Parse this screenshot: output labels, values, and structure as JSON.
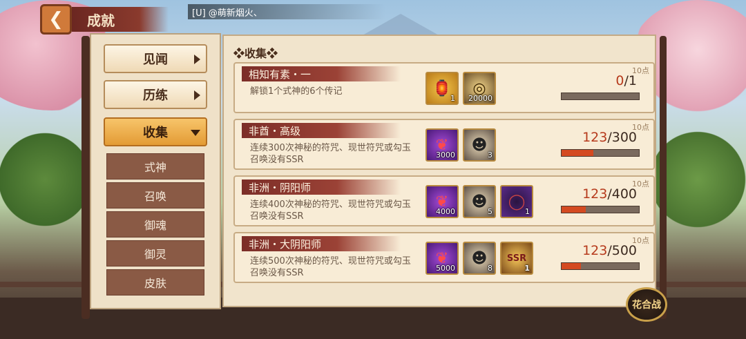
{
  "header": {
    "back_icon": "chevron-left-icon",
    "title": "成就",
    "chat_message": "[U] @萌新烟火、"
  },
  "sidebar": {
    "nav": [
      {
        "label": "见闻",
        "active": false
      },
      {
        "label": "历练",
        "active": false
      },
      {
        "label": "收集",
        "active": true
      }
    ],
    "sub_items": [
      "式神",
      "召唤",
      "御魂",
      "御灵",
      "皮肤"
    ]
  },
  "main": {
    "section_title": "❖收集❖",
    "achievements": [
      {
        "name": "相知有素・一",
        "desc": "解锁1个式神的6个传记",
        "points": "10点",
        "progress_current": "0",
        "progress_total": "/1",
        "progress_fraction": 0.0,
        "rewards": [
          {
            "icon": "gold-daruma-icon",
            "count": "1",
            "glyph": "🏮"
          },
          {
            "icon": "gold-coin-icon",
            "count": "20000",
            "glyph": "◎"
          }
        ]
      },
      {
        "name": "非酋・高级",
        "desc": "连续300次神秘的符咒、现世符咒或勾玉召唤没有SSR",
        "points": "10点",
        "progress_current": "123",
        "progress_total": "/300",
        "progress_fraction": 0.41,
        "rewards": [
          {
            "icon": "magatama-icon",
            "count": "3000",
            "glyph": "❦"
          },
          {
            "icon": "daruma-icon",
            "count": "3",
            "glyph": "☻"
          }
        ]
      },
      {
        "name": "非洲・阴阳师",
        "desc": "连续400次神秘的符咒、现世符咒或勾玉召唤没有SSR",
        "points": "10点",
        "progress_current": "123",
        "progress_total": "/400",
        "progress_fraction": 0.31,
        "rewards": [
          {
            "icon": "magatama-icon",
            "count": "4000",
            "glyph": "❦"
          },
          {
            "icon": "daruma-icon",
            "count": "5",
            "glyph": "☻"
          },
          {
            "icon": "ring-frame-icon",
            "count": "1",
            "glyph": "◯"
          }
        ]
      },
      {
        "name": "非洲・大阴阳师",
        "desc": "连续500次神秘的符咒、现世符咒或勾玉召唤没有SSR",
        "points": "10点",
        "progress_current": "123",
        "progress_total": "/500",
        "progress_fraction": 0.25,
        "rewards": [
          {
            "icon": "magatama-icon",
            "count": "5000",
            "glyph": "❦"
          },
          {
            "icon": "daruma-icon",
            "count": "8",
            "glyph": "☻"
          },
          {
            "icon": "ssr-frame-icon",
            "count": "1",
            "glyph": "SSR"
          }
        ]
      }
    ]
  },
  "huaheizhan_label": "花合战"
}
